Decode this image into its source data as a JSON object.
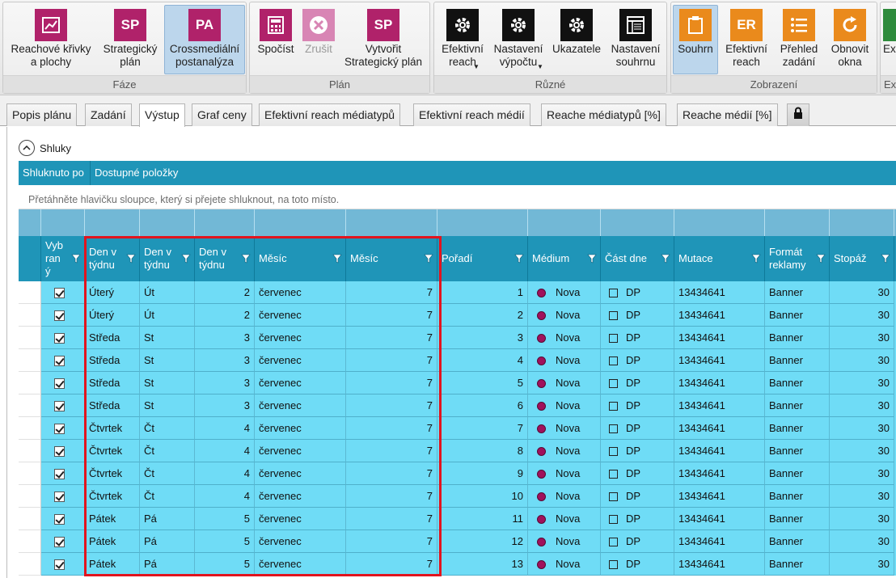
{
  "ribbon": {
    "groups": [
      {
        "label": "Fáze",
        "buttons": [
          {
            "icon": "reach-curves-chart-icon",
            "label": "Reachové křivky a plochy"
          },
          {
            "icon": "SP",
            "label": "Strategický plán"
          },
          {
            "icon": "PA",
            "label": "Crossmediální postanalýza"
          }
        ]
      },
      {
        "label": "Plán",
        "buttons": [
          {
            "icon": "calculator-icon",
            "label": "Spočíst"
          },
          {
            "icon": "cancel-icon",
            "label": "Zrušit"
          },
          {
            "icon": "SP",
            "label": "Vytvořit Strategický plán"
          }
        ]
      },
      {
        "label": "Různé",
        "buttons": [
          {
            "icon": "gear-icon",
            "label": "Efektivní reach"
          },
          {
            "icon": "gear-icon",
            "label": "Nastavení výpočtu"
          },
          {
            "icon": "gear-icon",
            "label": "Ukazatele"
          },
          {
            "icon": "summary-settings-icon",
            "label": "Nastavení souhrnu"
          }
        ]
      },
      {
        "label": "Zobrazení",
        "buttons": [
          {
            "icon": "clipboard-icon",
            "label": "Souhrn"
          },
          {
            "icon": "ER",
            "label": "Efektivní reach"
          },
          {
            "icon": "list-icon",
            "label": "Přehled zadání"
          },
          {
            "icon": "refresh-icon",
            "label": "Obnovit okna"
          }
        ]
      },
      {
        "label": "Ex",
        "buttons": [
          {
            "icon": "export-icon",
            "label": "Ex"
          }
        ]
      }
    ]
  },
  "tabs": [
    "Popis plánu",
    "Zadání",
    "Výstup",
    "Graf ceny",
    "Efektivní reach médiatypů",
    "Efektivní reach médií",
    "Reache médiatypů [%]",
    "Reache médií [%]"
  ],
  "active_tab": "Výstup",
  "shluky": {
    "label": "Shluky"
  },
  "groupbar": {
    "grouped_by": "Shluknuto po",
    "available": "Dostupné položky"
  },
  "hint": "Přetáhněte hlavičku sloupce, který si přejete shluknout, na toto místo.",
  "columns": [
    "Vyb ran ý",
    "Den v týdnu",
    "Den v týdnu",
    "Den v týdnu",
    "Měsíc",
    "Měsíc",
    "Pořadí",
    "Médium",
    "Část dne",
    "Mutace",
    "Formát reklamy",
    "Stopáž"
  ],
  "rows": [
    {
      "den": "Úterý",
      "den_short": "Út",
      "den_num": "2",
      "mesic": "červenec",
      "mesic_num": "7",
      "poradi": "1",
      "medium": "Nova",
      "cast_dne": "DP",
      "mutace": "13434641",
      "format": "Banner",
      "stopaz": "30"
    },
    {
      "den": "Úterý",
      "den_short": "Út",
      "den_num": "2",
      "mesic": "červenec",
      "mesic_num": "7",
      "poradi": "2",
      "medium": "Nova",
      "cast_dne": "DP",
      "mutace": "13434641",
      "format": "Banner",
      "stopaz": "30"
    },
    {
      "den": "Středa",
      "den_short": "St",
      "den_num": "3",
      "mesic": "červenec",
      "mesic_num": "7",
      "poradi": "3",
      "medium": "Nova",
      "cast_dne": "DP",
      "mutace": "13434641",
      "format": "Banner",
      "stopaz": "30"
    },
    {
      "den": "Středa",
      "den_short": "St",
      "den_num": "3",
      "mesic": "červenec",
      "mesic_num": "7",
      "poradi": "4",
      "medium": "Nova",
      "cast_dne": "DP",
      "mutace": "13434641",
      "format": "Banner",
      "stopaz": "30"
    },
    {
      "den": "Středa",
      "den_short": "St",
      "den_num": "3",
      "mesic": "červenec",
      "mesic_num": "7",
      "poradi": "5",
      "medium": "Nova",
      "cast_dne": "DP",
      "mutace": "13434641",
      "format": "Banner",
      "stopaz": "30"
    },
    {
      "den": "Středa",
      "den_short": "St",
      "den_num": "3",
      "mesic": "červenec",
      "mesic_num": "7",
      "poradi": "6",
      "medium": "Nova",
      "cast_dne": "DP",
      "mutace": "13434641",
      "format": "Banner",
      "stopaz": "30"
    },
    {
      "den": "Čtvrtek",
      "den_short": "Čt",
      "den_num": "4",
      "mesic": "červenec",
      "mesic_num": "7",
      "poradi": "7",
      "medium": "Nova",
      "cast_dne": "DP",
      "mutace": "13434641",
      "format": "Banner",
      "stopaz": "30"
    },
    {
      "den": "Čtvrtek",
      "den_short": "Čt",
      "den_num": "4",
      "mesic": "červenec",
      "mesic_num": "7",
      "poradi": "8",
      "medium": "Nova",
      "cast_dne": "DP",
      "mutace": "13434641",
      "format": "Banner",
      "stopaz": "30"
    },
    {
      "den": "Čtvrtek",
      "den_short": "Čt",
      "den_num": "4",
      "mesic": "červenec",
      "mesic_num": "7",
      "poradi": "9",
      "medium": "Nova",
      "cast_dne": "DP",
      "mutace": "13434641",
      "format": "Banner",
      "stopaz": "30"
    },
    {
      "den": "Čtvrtek",
      "den_short": "Čt",
      "den_num": "4",
      "mesic": "červenec",
      "mesic_num": "7",
      "poradi": "10",
      "medium": "Nova",
      "cast_dne": "DP",
      "mutace": "13434641",
      "format": "Banner",
      "stopaz": "30"
    },
    {
      "den": "Pátek",
      "den_short": "Pá",
      "den_num": "5",
      "mesic": "červenec",
      "mesic_num": "7",
      "poradi": "11",
      "medium": "Nova",
      "cast_dne": "DP",
      "mutace": "13434641",
      "format": "Banner",
      "stopaz": "30"
    },
    {
      "den": "Pátek",
      "den_short": "Pá",
      "den_num": "5",
      "mesic": "červenec",
      "mesic_num": "7",
      "poradi": "12",
      "medium": "Nova",
      "cast_dne": "DP",
      "mutace": "13434641",
      "format": "Banner",
      "stopaz": "30"
    },
    {
      "den": "Pátek",
      "den_short": "Pá",
      "den_num": "5",
      "mesic": "červenec",
      "mesic_num": "7",
      "poradi": "13",
      "medium": "Nova",
      "cast_dne": "DP",
      "mutace": "13434641",
      "format": "Banner",
      "stopaz": "30"
    }
  ],
  "colors": {
    "header_blue": "#1f95b8",
    "row_cyan": "#6fdcf6",
    "highlight_red": "#e2141e",
    "medium_dot": "#a0115c"
  }
}
